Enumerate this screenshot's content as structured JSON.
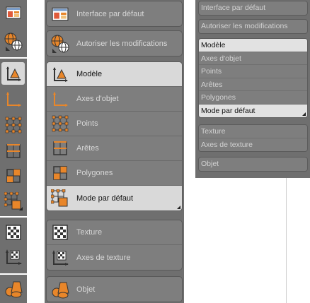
{
  "items": {
    "default_interface": "Interface par défaut",
    "allow_modifications": "Autoriser les modifications",
    "model": "Modèle",
    "object_axes": "Axes d'objet",
    "points": "Points",
    "edges": "Arêtes",
    "polygons": "Polygones",
    "default_mode": "Mode par défaut",
    "texture": "Texture",
    "texture_axes": "Axes de texture",
    "object": "Objet"
  },
  "selected": [
    "model",
    "default_mode"
  ],
  "colors": {
    "panel_bg": "#6f6f6f",
    "button_bg": "#7e7e7e",
    "selected_bg": "#d9d9d9",
    "accent_orange": "#e8862a",
    "label_text": "#d8d8d8"
  },
  "icons": [
    "interface-icon",
    "globe-edit-icon",
    "model-icon",
    "object-axes-icon",
    "points-icon",
    "edges-icon",
    "polygons-icon",
    "default-mode-icon",
    "texture-icon",
    "texture-axes-icon",
    "object-icon"
  ]
}
